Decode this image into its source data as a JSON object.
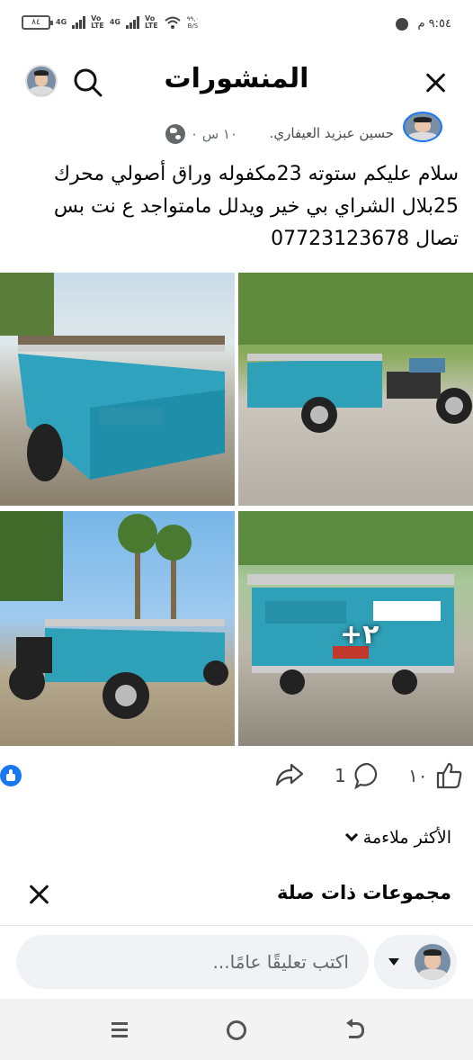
{
  "status_bar": {
    "battery": "٨٤",
    "network_1": "4G",
    "network_2": "Vo\nLTE",
    "network_3": "4G",
    "network_4": "Vo\nLTE",
    "speed": "٩٩,٠\nB/S",
    "time": "٩:٥٤ م",
    "messenger_icon": "messenger-icon"
  },
  "header": {
    "title": "المنشورات",
    "close_icon": "close-icon",
    "search_icon": "search-icon"
  },
  "post": {
    "author": "حسين عبزيد العيفاري.",
    "time": "١٠ س ٠",
    "text": "سلام عليكم ستوته 23مكفوله وراق أصولي محرك 25بلال الشراي بي خير ويدلل مامتواجد ع نت بس تصال 07723123678",
    "more_photos_badge": "٢+"
  },
  "actions": {
    "like_count": "١٠",
    "comment_count": "1",
    "colors": {
      "facebook_blue": "#1877f2"
    }
  },
  "sort": {
    "label": "الأكثر ملاءمة"
  },
  "related_groups": {
    "title": "مجموعات ذات صلة"
  },
  "comment": {
    "placeholder": "اكتب تعليقًا عامًا..."
  }
}
